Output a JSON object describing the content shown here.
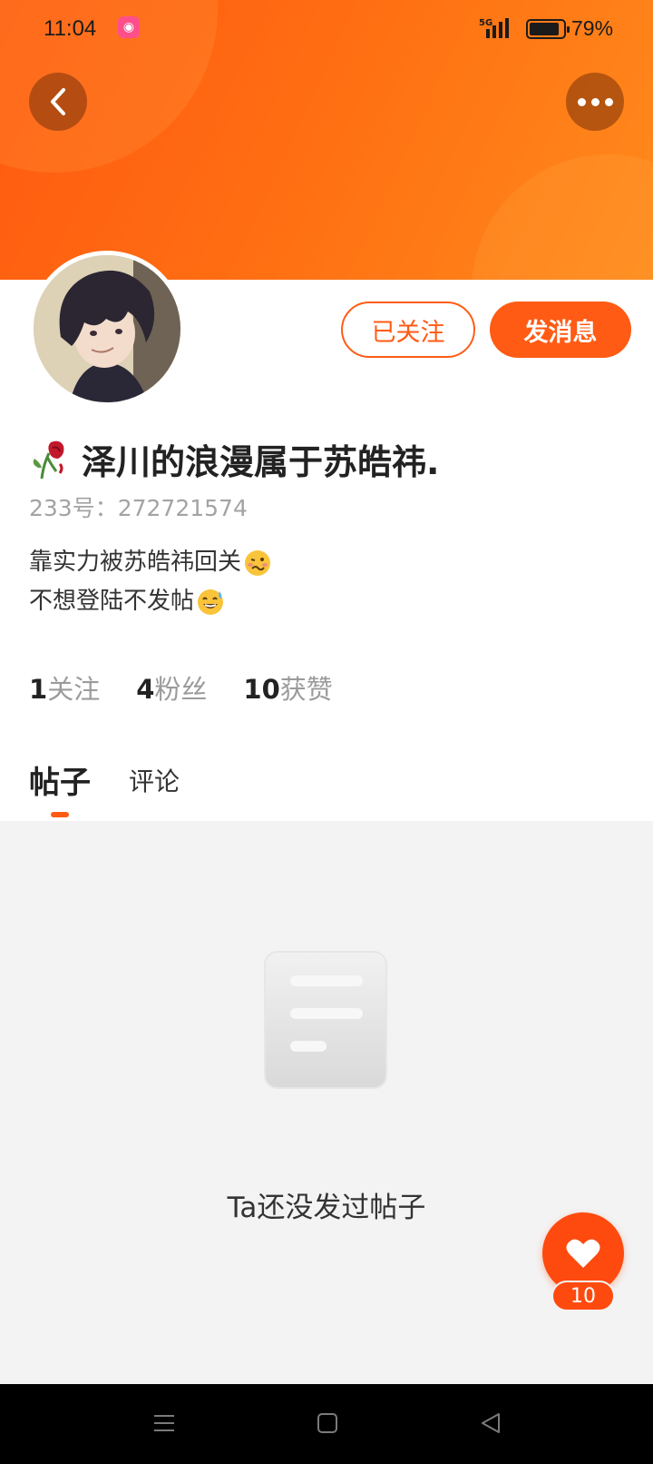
{
  "status_bar": {
    "time": "11:04",
    "network": "5G",
    "battery_percent_text": "79%",
    "battery_level": 0.79
  },
  "header": {
    "back_icon": "chevron-left-icon",
    "more_icon": "more-dots-icon",
    "colors": {
      "gradient_start": "#ff5a10",
      "gradient_end": "#ff8a1c"
    }
  },
  "profile": {
    "follow_button_label": "已关注",
    "message_button_label": "发消息",
    "name": "泽川的浪漫属于苏皓祎.",
    "uid_label": "233号：",
    "uid": "272721574",
    "bio_lines": [
      "靠实力被苏皓祎回关",
      "不想登陆不发帖"
    ],
    "stats": [
      {
        "count": "1",
        "label": "关注"
      },
      {
        "count": "4",
        "label": "粉丝"
      },
      {
        "count": "10",
        "label": "获赞"
      }
    ]
  },
  "tabs": [
    {
      "label": "帖子",
      "active": true
    },
    {
      "label": "评论",
      "active": false
    }
  ],
  "empty_state": {
    "icon": "document-icon",
    "text": "Ta还没发过帖子"
  },
  "like_fab": {
    "icon": "heart-icon",
    "count": "10"
  },
  "accent_color": "#ff5b14"
}
